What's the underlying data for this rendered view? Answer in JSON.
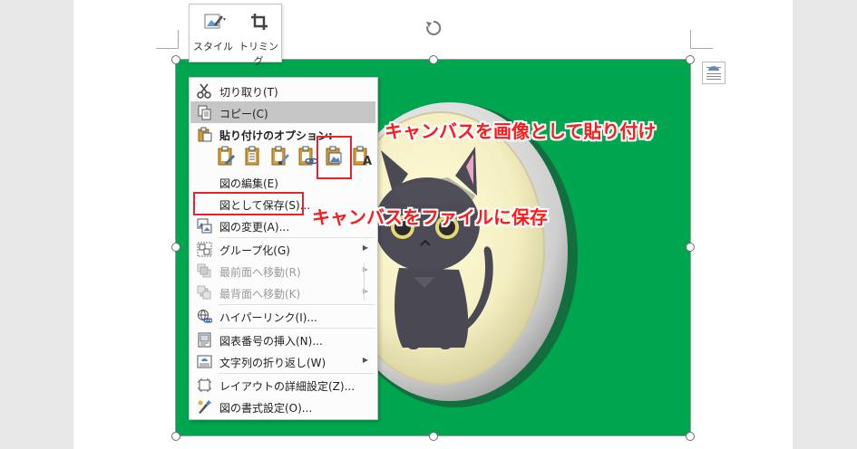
{
  "mini_toolbar": {
    "style_label": "スタイル",
    "trim_label": "トリミング"
  },
  "context_menu": {
    "cut": "切り取り(T)",
    "copy": "コピー(C)",
    "paste_options_header": "貼り付けのオプション:",
    "edit_picture": "図の編集(E)",
    "save_as_picture": "図として保存(S)...",
    "change_picture": "図の変更(A)...",
    "group": "グループ化(G)",
    "bring_to_front": "最前面へ移動(R)",
    "send_to_back": "最背面へ移動(K)",
    "hyperlink": "ハイパーリンク(I)...",
    "insert_caption": "図表番号の挿入(N)...",
    "wrap_text": "文字列の折り返し(W)",
    "layout_details": "レイアウトの詳細設定(Z)...",
    "format_picture": "図の書式設定(O)..."
  },
  "callouts": {
    "paste_as_image": "キャンバスを画像として貼り付け",
    "save_to_file": "キャンバスをファイルに保存"
  },
  "colors": {
    "picture_bg": "#00a64f",
    "callout": "#ff1a1a",
    "highlight": "#e8222f"
  }
}
